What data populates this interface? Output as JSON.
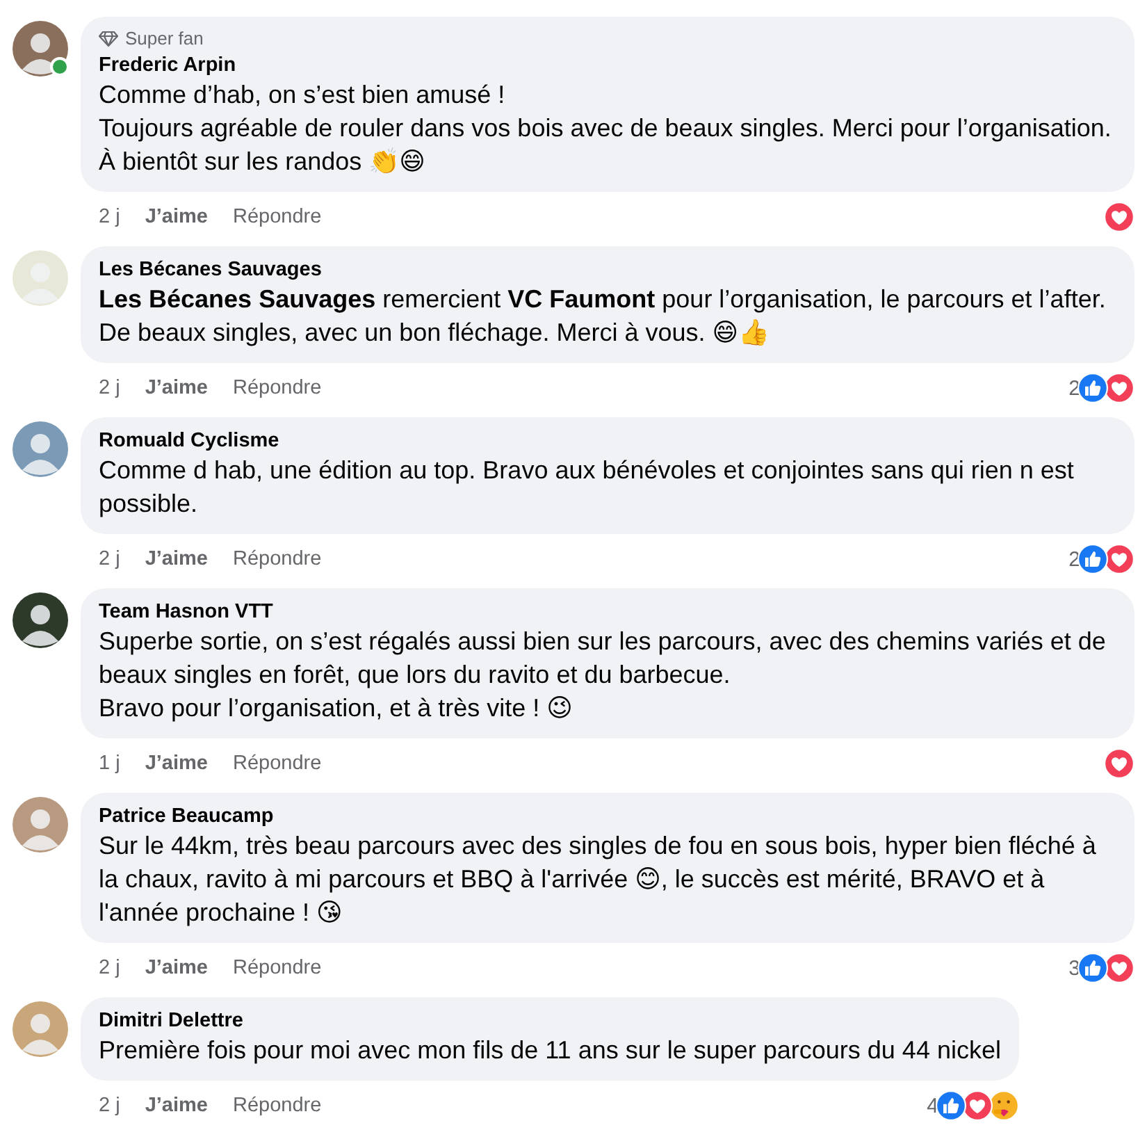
{
  "comments": [
    {
      "author": "Frederic Arpin",
      "badge": "Super fan",
      "online": true,
      "paragraphs": [
        "Comme d’hab, on s’est bien amusé !",
        "Toujours agréable de rouler dans vos bois avec de beaux singles. Merci pour l’organisation. À bientôt sur les randos 👏😄"
      ],
      "time": "2 j",
      "like": "J’aime",
      "reply": "Répondre",
      "reactions": [
        {
          "kind": "love"
        }
      ]
    },
    {
      "author": "Les Bécanes Sauvages",
      "online": false,
      "paragraphs": [
        "**Les Bécanes Sauvages** remercient **VC Faumont** pour l’organisation, le parcours et l’after. De beaux singles, avec un bon fléchage. Merci à vous. 😄👍"
      ],
      "time": "2 j",
      "like": "J’aime",
      "reply": "Répondre",
      "count": "2",
      "reactions": [
        {
          "kind": "like"
        },
        {
          "kind": "love"
        }
      ]
    },
    {
      "author": "Romuald Cyclisme",
      "online": false,
      "paragraphs": [
        "Comme d hab, une édition au top. Bravo aux bénévoles et conjointes sans qui rien n est possible."
      ],
      "time": "2 j",
      "like": "J’aime",
      "reply": "Répondre",
      "count": "2",
      "reactions": [
        {
          "kind": "like"
        },
        {
          "kind": "love"
        }
      ]
    },
    {
      "author": "Team Hasnon VTT",
      "online": false,
      "paragraphs": [
        "Superbe sortie, on s’est régalés aussi bien sur les parcours, avec des chemins variés et de beaux singles en forêt, que lors du ravito et du barbecue.",
        "Bravo pour l’organisation, et à très vite ! 😉"
      ],
      "time": "1 j",
      "like": "J’aime",
      "reply": "Répondre",
      "reactions": [
        {
          "kind": "love"
        }
      ]
    },
    {
      "author": "Patrice Beaucamp",
      "online": false,
      "paragraphs": [
        "Sur le 44km, très beau parcours avec des singles de fou en sous bois, hyper bien fléché à la chaux, ravito à mi parcours et BBQ à l'arrivée 😊, le succès est mérité, BRAVO et à l'année prochaine ! 😘"
      ],
      "time": "2 j",
      "like": "J’aime",
      "reply": "Répondre",
      "count": "3",
      "reactions": [
        {
          "kind": "like"
        },
        {
          "kind": "love"
        }
      ]
    },
    {
      "author": "Dimitri Delettre",
      "online": false,
      "paragraphs": [
        "Première fois pour moi avec mon fils de 11 ans sur le super parcours du 44 nickel"
      ],
      "time": "2 j",
      "like": "J’aime",
      "reply": "Répondre",
      "count": "4",
      "reactions": [
        {
          "kind": "like"
        },
        {
          "kind": "love"
        },
        {
          "kind": "care"
        }
      ]
    }
  ]
}
